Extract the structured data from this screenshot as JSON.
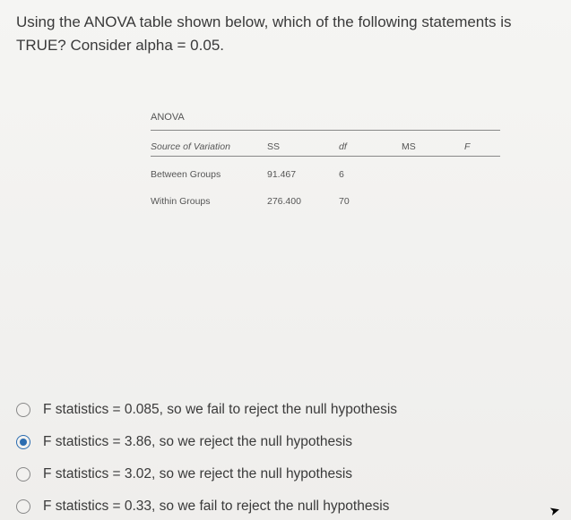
{
  "question": {
    "line1": "Using the ANOVA table shown below, which of the following statements is",
    "line2": "TRUE? Consider alpha = 0.05."
  },
  "anova": {
    "title": "ANOVA",
    "headers": {
      "source": "Source of Variation",
      "ss": "SS",
      "df": "df",
      "ms": "MS",
      "f": "F"
    },
    "rows": [
      {
        "source": "Between Groups",
        "ss": "91.467",
        "df": "6",
        "ms": "",
        "f": ""
      },
      {
        "source": "Within Groups",
        "ss": "276.400",
        "df": "70",
        "ms": "",
        "f": ""
      }
    ]
  },
  "options": [
    {
      "text": "F statistics = 0.085, so we fail to reject the null hypothesis",
      "selected": false
    },
    {
      "text": "F statistics = 3.86, so we reject the null hypothesis",
      "selected": true
    },
    {
      "text": "F statistics = 3.02, so we reject the null hypothesis",
      "selected": false
    },
    {
      "text": "F statistics = 0.33, so we fail to reject the null hypothesis",
      "selected": false
    }
  ]
}
